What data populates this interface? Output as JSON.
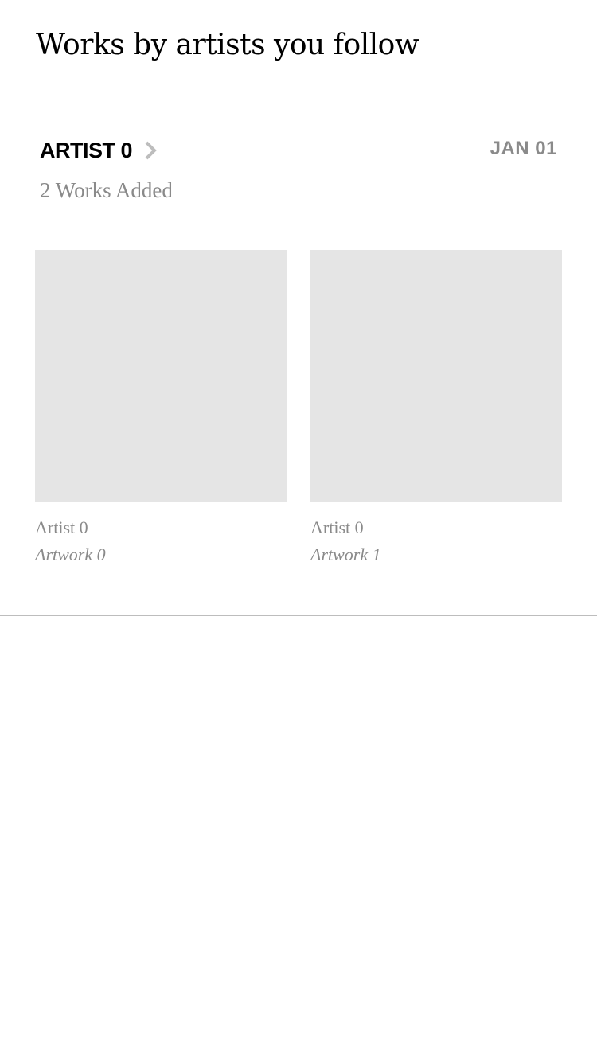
{
  "page": {
    "title": "Works by artists you follow"
  },
  "artist_group": {
    "name": "ARTIST 0",
    "date": "JAN 01",
    "works_added": "2 Works Added",
    "chevron_icon": "chevron-right-icon"
  },
  "artworks": [
    {
      "artist": "Artist 0",
      "title": "Artwork 0"
    },
    {
      "artist": "Artist 0",
      "title": "Artwork 1"
    }
  ],
  "colors": {
    "placeholder_image": "#e5e5e5",
    "secondary_text": "#8a8a8a",
    "chevron": "#bdbdbd",
    "divider": "#bdbdbd"
  }
}
